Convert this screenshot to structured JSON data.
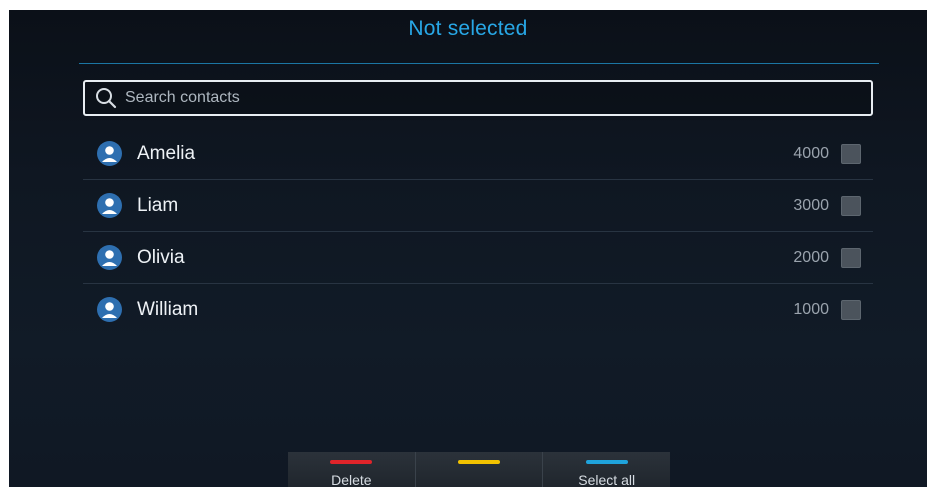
{
  "header": {
    "title": "Not selected"
  },
  "search": {
    "placeholder": "Search contacts",
    "value": ""
  },
  "contacts": [
    {
      "name": "Amelia",
      "number": "4000",
      "checked": false
    },
    {
      "name": "Liam",
      "number": "3000",
      "checked": false
    },
    {
      "name": "Olivia",
      "number": "2000",
      "checked": false
    },
    {
      "name": "William",
      "number": "1000",
      "checked": false
    }
  ],
  "softkeys": [
    {
      "label": "Delete",
      "color": "#e0242a"
    },
    {
      "label": "",
      "color": "#f2c200"
    },
    {
      "label": "Select all",
      "color": "#1fa3dc"
    }
  ],
  "colors": {
    "accent": "#28a7e6",
    "avatar": "#2e6fb0"
  }
}
